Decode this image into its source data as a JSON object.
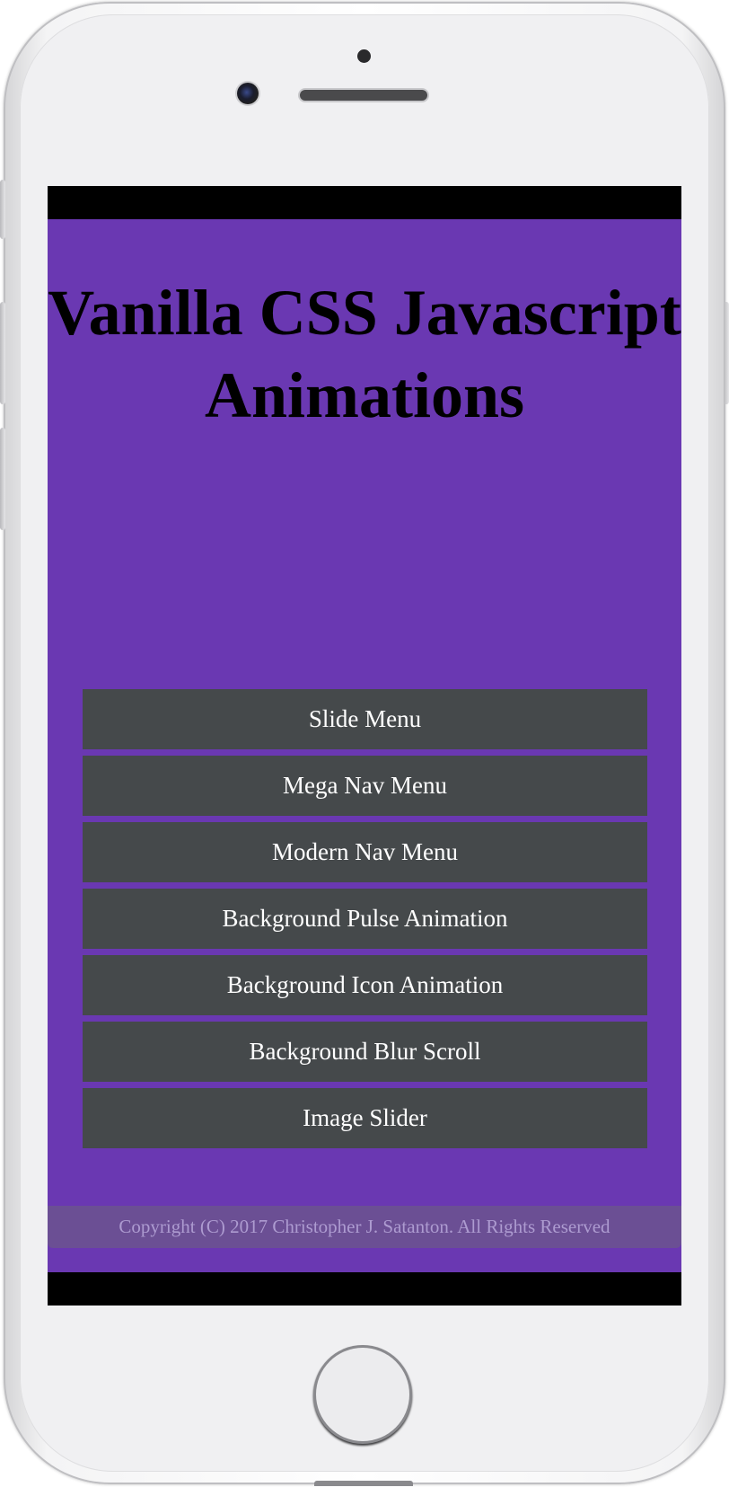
{
  "page": {
    "title": "Vanilla CSS Javascript Animations"
  },
  "menu": {
    "items": [
      {
        "label": "Slide Menu"
      },
      {
        "label": "Mega Nav Menu"
      },
      {
        "label": "Modern Nav Menu"
      },
      {
        "label": "Background Pulse Animation"
      },
      {
        "label": "Background Icon Animation"
      },
      {
        "label": "Background Blur Scroll"
      },
      {
        "label": "Image Slider"
      }
    ]
  },
  "footer": {
    "copyright": "Copyright (C) 2017 Christopher J. Satanton. All Rights Reserved"
  },
  "colors": {
    "background": "#6a38b2",
    "menu_item": "#45494b",
    "menu_text": "#ffffff",
    "title_text": "#000000",
    "footer_bg": "#6b4f94",
    "footer_text": "#ad9bd0"
  }
}
